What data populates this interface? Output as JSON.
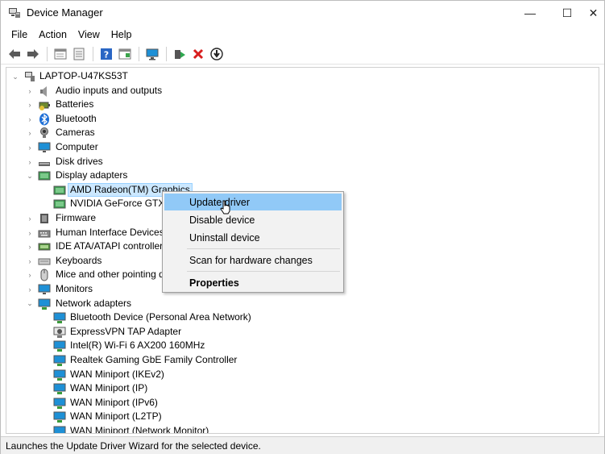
{
  "window": {
    "title": "Device Manager",
    "controls": {
      "minimize": "—",
      "maximize": "☐",
      "close": "✕"
    }
  },
  "menu": {
    "items": [
      "File",
      "Action",
      "View",
      "Help"
    ]
  },
  "toolbar": {
    "buttons": [
      "back-arrow-icon",
      "forward-arrow-icon",
      "properties-icon",
      "device-list-icon",
      "help-icon",
      "resource-view-icon",
      "monitor-scan-icon",
      "update-driver-icon",
      "uninstall-x-icon",
      "download-icon"
    ]
  },
  "tree": {
    "root": "LAPTOP-U47KS53T",
    "categories": {
      "audio": "Audio inputs and outputs",
      "batteries": "Batteries",
      "bluetooth": "Bluetooth",
      "cameras": "Cameras",
      "computer": "Computer",
      "disk": "Disk drives",
      "display": "Display adapters",
      "firmware": "Firmware",
      "hid": "Human Interface Devices",
      "ide": "IDE ATA/ATAPI controllers",
      "keyboards": "Keyboards",
      "mice": "Mice and other pointing d",
      "monitors": "Monitors",
      "network": "Network adapters"
    },
    "display_children": [
      "AMD Radeon(TM) Graphics",
      "NVIDIA GeForce GTX 1"
    ],
    "network_children": [
      "Bluetooth Device (Personal Area Network)",
      "ExpressVPN TAP Adapter",
      "Intel(R) Wi-Fi 6 AX200 160MHz",
      "Realtek Gaming GbE Family Controller",
      "WAN Miniport (IKEv2)",
      "WAN Miniport (IP)",
      "WAN Miniport (IPv6)",
      "WAN Miniport (L2TP)",
      "WAN Miniport (Network Monitor)"
    ]
  },
  "context_menu": {
    "update": "Update driver",
    "disable": "Disable device",
    "uninstall": "Uninstall device",
    "scan": "Scan for hardware changes",
    "properties": "Properties"
  },
  "status": {
    "text": "Launches the Update Driver Wizard for the selected device."
  },
  "colors": {
    "selection": "#cce8ff",
    "menu_highlight": "#91c9f7",
    "accent_blue": "#1e90d6"
  }
}
